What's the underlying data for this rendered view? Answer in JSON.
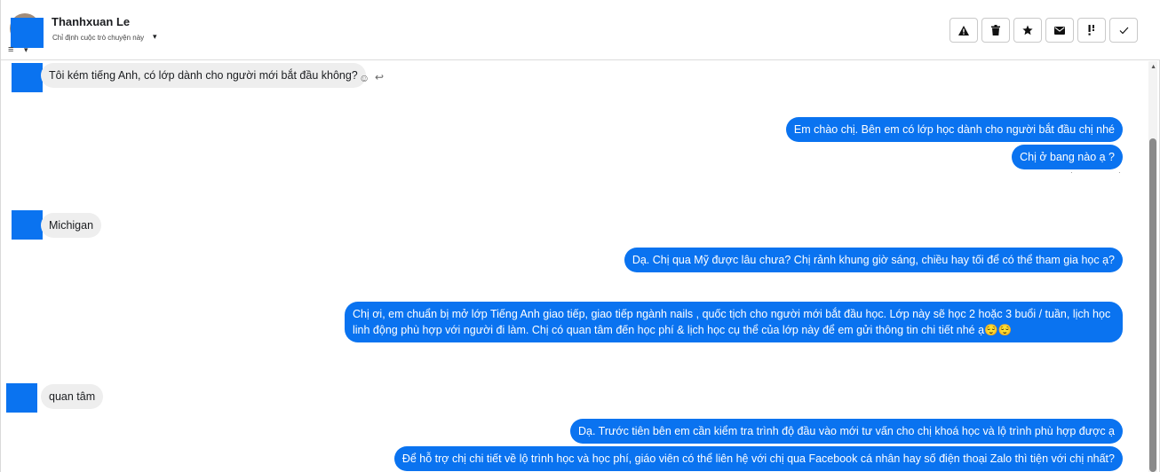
{
  "header": {
    "contact_name": "Thanhxuan Le",
    "assign_label": "Chỉ định cuộc trò chuyện này",
    "assign_caret": "▾",
    "filter_icon": "≡",
    "actions": [
      {
        "name": "report-spam-button",
        "icon": "warning-icon"
      },
      {
        "name": "delete-button",
        "icon": "trash-icon"
      },
      {
        "name": "star-button",
        "icon": "star-icon"
      },
      {
        "name": "mark-unread-button",
        "icon": "envelope-icon"
      },
      {
        "name": "follow-up-button",
        "icon": "exclamation-icon"
      },
      {
        "name": "mark-done-button",
        "icon": "check-icon"
      }
    ]
  },
  "messages": [
    {
      "id": "m1",
      "direction": "in",
      "text": "Tôi kém tiếng Anh, có lớp dành cho người mới bắt đầu không?"
    },
    {
      "id": "m2",
      "direction": "out",
      "text": "Em chào chị. Bên em có lớp học dành cho người bắt đầu chị nhé"
    },
    {
      "id": "m3",
      "direction": "out",
      "text": "Chị ở bang nào ạ ?"
    },
    {
      "id": "m4",
      "direction": "in",
      "text": "Michigan"
    },
    {
      "id": "m5",
      "direction": "out",
      "text": "Dạ. Chị qua Mỹ được lâu chưa? Chị rảnh khung giờ sáng, chiều hay tối để có thể tham gia học ạ?"
    },
    {
      "id": "m6",
      "direction": "out",
      "text": "Chị ơi, em chuẩn bị mở lớp Tiếng Anh giao tiếp, giao tiếp ngành nails , quốc tịch cho người mới bắt đầu học. Lớp này sẽ học 2 hoặc 3 buổi / tuần, lịch học linh động phù hợp với người đi làm. Chị có quan tâm đến học phí & lịch học cụ thể của lớp này để em  gửi thông tin chi tiết nhé ạ😌😌"
    },
    {
      "id": "m7",
      "direction": "in",
      "text": "quan tâm"
    },
    {
      "id": "m8",
      "direction": "out",
      "text": "Dạ. Trước tiên bên em cần kiểm tra trình độ đầu vào mới tư vấn cho chị khoá học và lộ trình phù hợp được ạ"
    },
    {
      "id": "m9",
      "direction": "out",
      "text": "Để hỗ trợ chị chi tiết về lộ trình học và học phí, giáo viên có thể liên hệ với chị qua Facebook cá nhân hay số điện thoại Zalo thì tiện với chị nhất?"
    }
  ],
  "message_tools": {
    "react_icon": "☺",
    "reply_icon": "↩"
  },
  "colors": {
    "outgoing_bubble": "#0a73f0",
    "incoming_bubble": "#eeeeee",
    "avatar_placeholder": "#0a73f0"
  }
}
